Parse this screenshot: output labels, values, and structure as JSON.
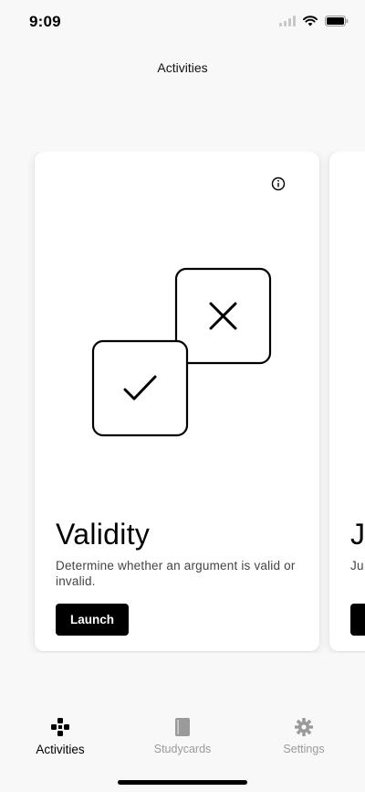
{
  "status": {
    "time": "9:09",
    "icons": [
      "signal-icon",
      "wifi-icon",
      "battery-icon"
    ]
  },
  "header": {
    "title": "Activities"
  },
  "cards": [
    {
      "title": "Validity",
      "description": "Determine whether an argument is valid or invalid.",
      "launch_label": "Launch",
      "icon": "info-icon",
      "illustration": [
        "checkmark-box-icon",
        "cross-box-icon"
      ]
    },
    {
      "title": "J",
      "description": "Ju mi",
      "launch_label": ""
    }
  ],
  "tabs": [
    {
      "label": "Activities",
      "icon": "gamepad-icon",
      "active": true
    },
    {
      "label": "Studycards",
      "icon": "book-icon",
      "active": false
    },
    {
      "label": "Settings",
      "icon": "gear-icon",
      "active": false
    }
  ],
  "colors": {
    "background": "#f8f8f8",
    "card": "#ffffff",
    "primary_button": "#000000",
    "inactive_tab": "#9a9a9a"
  }
}
